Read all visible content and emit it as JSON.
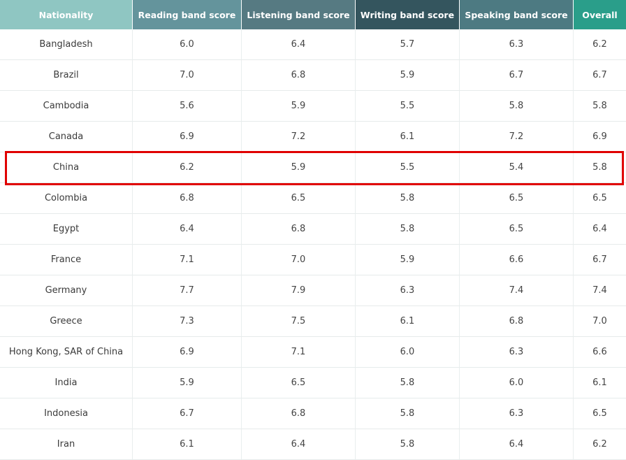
{
  "headers": [
    "Nationality",
    "Reading band score",
    "Listening band score",
    "Writing band score",
    "Speaking band score",
    "Overall"
  ],
  "rows": [
    [
      "Bangladesh",
      "6.0",
      "6.4",
      "5.7",
      "6.3",
      "6.2"
    ],
    [
      "Brazil",
      "7.0",
      "6.8",
      "5.9",
      "6.7",
      "6.7"
    ],
    [
      "Cambodia",
      "5.6",
      "5.9",
      "5.5",
      "5.8",
      "5.8"
    ],
    [
      "Canada",
      "6.9",
      "7.2",
      "6.1",
      "7.2",
      "6.9"
    ],
    [
      "China",
      "6.2",
      "5.9",
      "5.5",
      "5.4",
      "5.8"
    ],
    [
      "Colombia",
      "6.8",
      "6.5",
      "5.8",
      "6.5",
      "6.5"
    ],
    [
      "Egypt",
      "6.4",
      "6.8",
      "5.8",
      "6.5",
      "6.4"
    ],
    [
      "France",
      "7.1",
      "7.0",
      "5.9",
      "6.6",
      "6.7"
    ],
    [
      "Germany",
      "7.7",
      "7.9",
      "6.3",
      "7.4",
      "7.4"
    ],
    [
      "Greece",
      "7.3",
      "7.5",
      "6.1",
      "6.8",
      "7.0"
    ],
    [
      "Hong Kong, SAR of China",
      "6.9",
      "7.1",
      "6.0",
      "6.3",
      "6.6"
    ],
    [
      "India",
      "5.9",
      "6.5",
      "5.8",
      "6.0",
      "6.1"
    ],
    [
      "Indonesia",
      "6.7",
      "6.8",
      "5.8",
      "6.3",
      "6.5"
    ],
    [
      "Iran",
      "6.1",
      "6.4",
      "5.8",
      "6.4",
      "6.2"
    ]
  ],
  "highlighted_row": "China",
  "colors": {
    "header_nationality": "#8fc6c2",
    "header_reading": "#64949c",
    "header_listening": "#567a82",
    "header_writing": "#34555e",
    "header_speaking": "#4d7a82",
    "header_overall": "#2a9e8a",
    "highlight_border": "#e00000"
  }
}
